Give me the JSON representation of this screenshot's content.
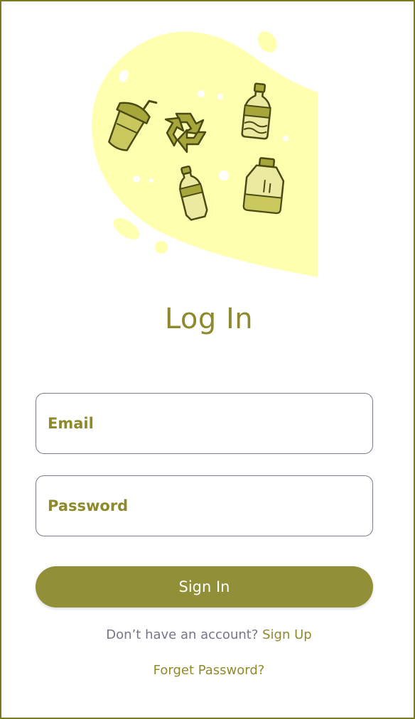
{
  "hero": {
    "blob_color": "#ffffb0",
    "icon_color": "#a7a63a",
    "icons": [
      "cup-with-straw-icon",
      "recycle-icon",
      "bottle-icon",
      "plastic-bottle-icon",
      "jug-icon"
    ]
  },
  "title": "Log In",
  "email": {
    "placeholder": "Email",
    "value": ""
  },
  "password": {
    "placeholder": "Password",
    "value": ""
  },
  "sign_in_label": "Sign In",
  "signup_prompt": "Don’t have an account?",
  "signup_link": "Sign Up",
  "forgot_link": "Forget Password?",
  "colors": {
    "accent": "#918f38",
    "text_accent": "#8e8a2c",
    "muted": "#777586",
    "frame_border": "#7a7a1e"
  }
}
